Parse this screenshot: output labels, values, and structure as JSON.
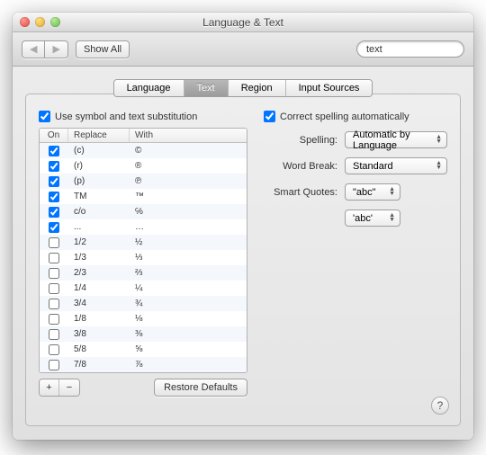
{
  "window": {
    "title": "Language & Text"
  },
  "toolbar": {
    "showAll": "Show All",
    "search_value": "text"
  },
  "tabs": [
    "Language",
    "Text",
    "Region",
    "Input Sources"
  ],
  "activeTab": 1,
  "left": {
    "checkbox_label": "Use symbol and text substitution",
    "checkbox_on": true,
    "headers": {
      "on": "On",
      "replace": "Replace",
      "with": "With"
    },
    "rows": [
      {
        "on": true,
        "replace": "(c)",
        "with": "©"
      },
      {
        "on": true,
        "replace": "(r)",
        "with": "®"
      },
      {
        "on": true,
        "replace": "(p)",
        "with": "℗"
      },
      {
        "on": true,
        "replace": "TM",
        "with": "™"
      },
      {
        "on": true,
        "replace": "c/o",
        "with": "℅"
      },
      {
        "on": true,
        "replace": "...",
        "with": "…"
      },
      {
        "on": false,
        "replace": "1/2",
        "with": "½"
      },
      {
        "on": false,
        "replace": "1/3",
        "with": "⅓"
      },
      {
        "on": false,
        "replace": "2/3",
        "with": "⅔"
      },
      {
        "on": false,
        "replace": "1/4",
        "with": "¼"
      },
      {
        "on": false,
        "replace": "3/4",
        "with": "¾"
      },
      {
        "on": false,
        "replace": "1/8",
        "with": "⅛"
      },
      {
        "on": false,
        "replace": "3/8",
        "with": "⅜"
      },
      {
        "on": false,
        "replace": "5/8",
        "with": "⅝"
      },
      {
        "on": false,
        "replace": "7/8",
        "with": "⅞"
      }
    ],
    "add_label": "+",
    "remove_label": "−",
    "restore_label": "Restore Defaults"
  },
  "right": {
    "correct_label": "Correct spelling automatically",
    "correct_on": true,
    "spelling_label": "Spelling:",
    "spelling_value": "Automatic by Language",
    "wordbreak_label": "Word Break:",
    "wordbreak_value": "Standard",
    "smartquotes_label": "Smart Quotes:",
    "smartquotes_double": "\"abc\"",
    "smartquotes_single": "'abc'"
  },
  "help_label": "?"
}
